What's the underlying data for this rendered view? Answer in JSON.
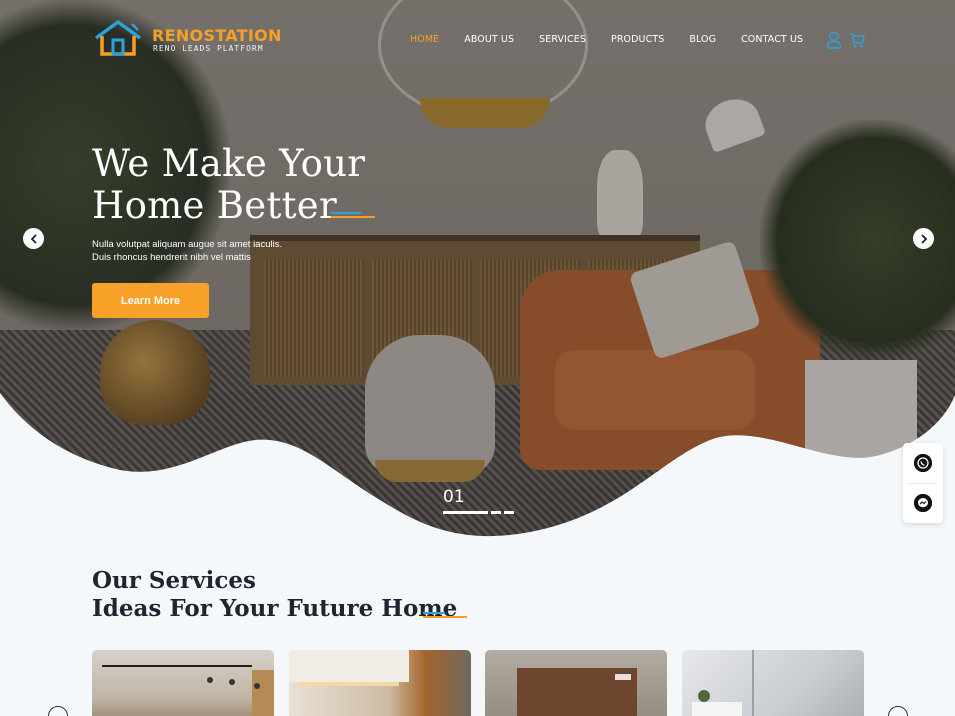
{
  "brand": {
    "name": "RENOSTATION",
    "tagline": "RENO LEADS PLATFORM",
    "primary_color": "#f5a127",
    "accent_blue": "#2ea0dc"
  },
  "nav": {
    "items": [
      {
        "label": "HOME",
        "active": true
      },
      {
        "label": "ABOUT US",
        "active": false
      },
      {
        "label": "SERVICES",
        "active": false
      },
      {
        "label": "PRODUCTS",
        "active": false
      },
      {
        "label": "BLOG",
        "active": false
      },
      {
        "label": "CONTACT US",
        "active": false
      }
    ],
    "icons": [
      "user-icon",
      "cart-icon"
    ]
  },
  "hero": {
    "title_line1": "We Make Your",
    "title_line2": "Home Better",
    "subtitle_line1": "Nulla volutpat aliquam augue sit amet iaculis.",
    "subtitle_line2": "Duis rhoncus hendrerit nibh vel mattis",
    "cta_label": "Learn More",
    "slide_number": "01",
    "prev_icon": "chevron-left-icon",
    "next_icon": "chevron-right-icon"
  },
  "floating_contacts": [
    "whatsapp-icon",
    "messenger-icon"
  ],
  "services": {
    "heading_line1": "Our Services",
    "heading_line2": "Ideas For Your Future Home",
    "cards": [
      "service-card-1",
      "service-card-2",
      "service-card-3",
      "service-card-4"
    ]
  }
}
